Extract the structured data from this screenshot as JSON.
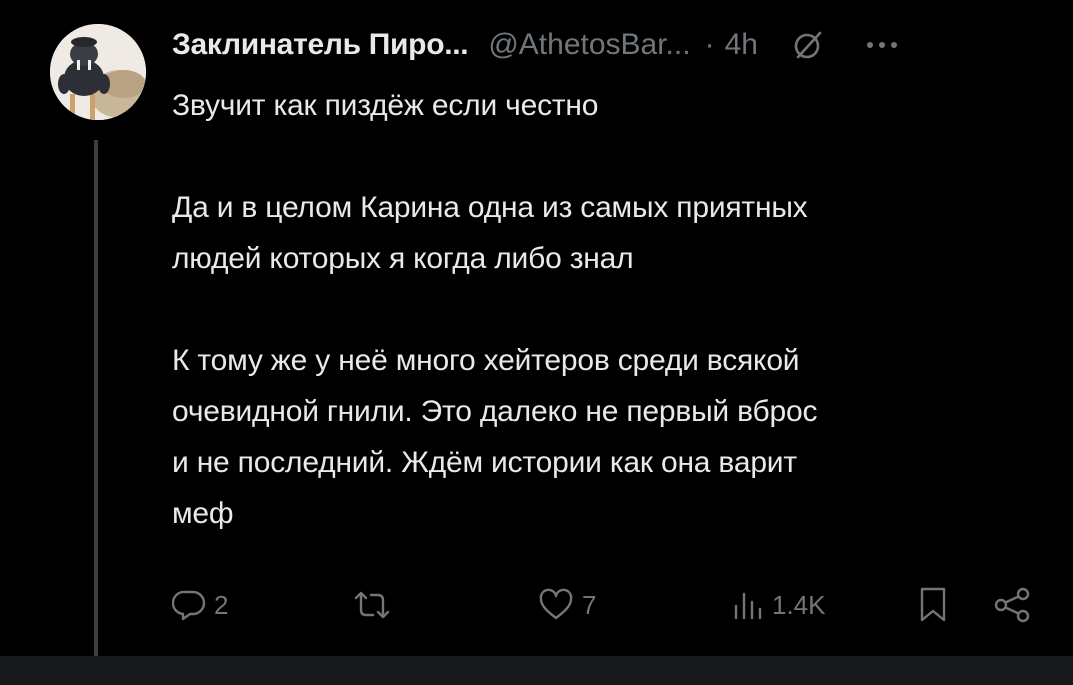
{
  "tweet": {
    "author_name": "Заклинатель Пиро...",
    "author_handle": "@AthetosBar...",
    "separator": "·",
    "time": "4h",
    "body_paragraphs": [
      [
        "Звучит как пиздёж если честно"
      ],
      [
        "Да и в целом Карина одна из самых приятных",
        "людей которых я когда либо знал"
      ],
      [
        "К тому же у неё много хейтеров среди всякой",
        "очевидной гнили. Это далеко не первый вброс",
        "и не последний. Ждём истории как она варит",
        "меф"
      ]
    ],
    "actions": {
      "reply_count": "2",
      "retweet_count": "",
      "like_count": "7",
      "views_count": "1.4K"
    }
  },
  "icons": {
    "avatar": "walrus-figurine-avatar",
    "grok": "grok-icon",
    "more": "more-dots-icon",
    "reply": "reply-icon",
    "retweet": "retweet-icon",
    "like": "heart-icon",
    "views": "views-bar-chart-icon",
    "bookmark": "bookmark-icon",
    "share": "share-icon"
  },
  "colors": {
    "background": "#000000",
    "text_primary": "#e7e9ea",
    "text_secondary": "#71767b",
    "thread_line": "#3b3d40"
  }
}
